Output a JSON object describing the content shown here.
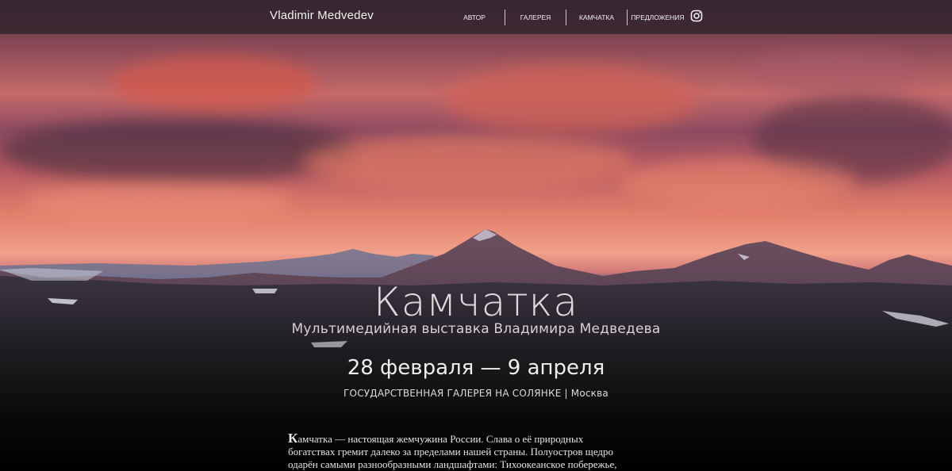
{
  "header": {
    "brand": "Vladimir Medvedev",
    "nav": [
      {
        "label": "АВТОР"
      },
      {
        "label": "ГАЛЕРЕЯ"
      },
      {
        "label": "КАМЧАТКА"
      },
      {
        "label": "ПРЕДЛОЖЕНИЯ"
      }
    ],
    "social_icon": "instagram-icon"
  },
  "hero": {
    "title": "Камчатка",
    "subtitle": "Мультимедийная выставка Владимира Медведева",
    "dates": "28 февраля — 9 апреля",
    "venue": "ГОСУДАРСТВЕННАЯ ГАЛЕРЕЯ НА СОЛЯНКЕ | Москва"
  },
  "intro": {
    "dropcap": "К",
    "lines": [
      "амчатка — настоящая жемчужина России. Слава о её природных",
      "богатствах гремит далеко за пределами нашей страны. Полуостров щедро",
      "одарён самыми разнообразными ландшафтами: Тихоокеанское побережье,"
    ]
  },
  "colors": {
    "nav_bar": "#282028",
    "text_light": "#f0f0f0"
  }
}
